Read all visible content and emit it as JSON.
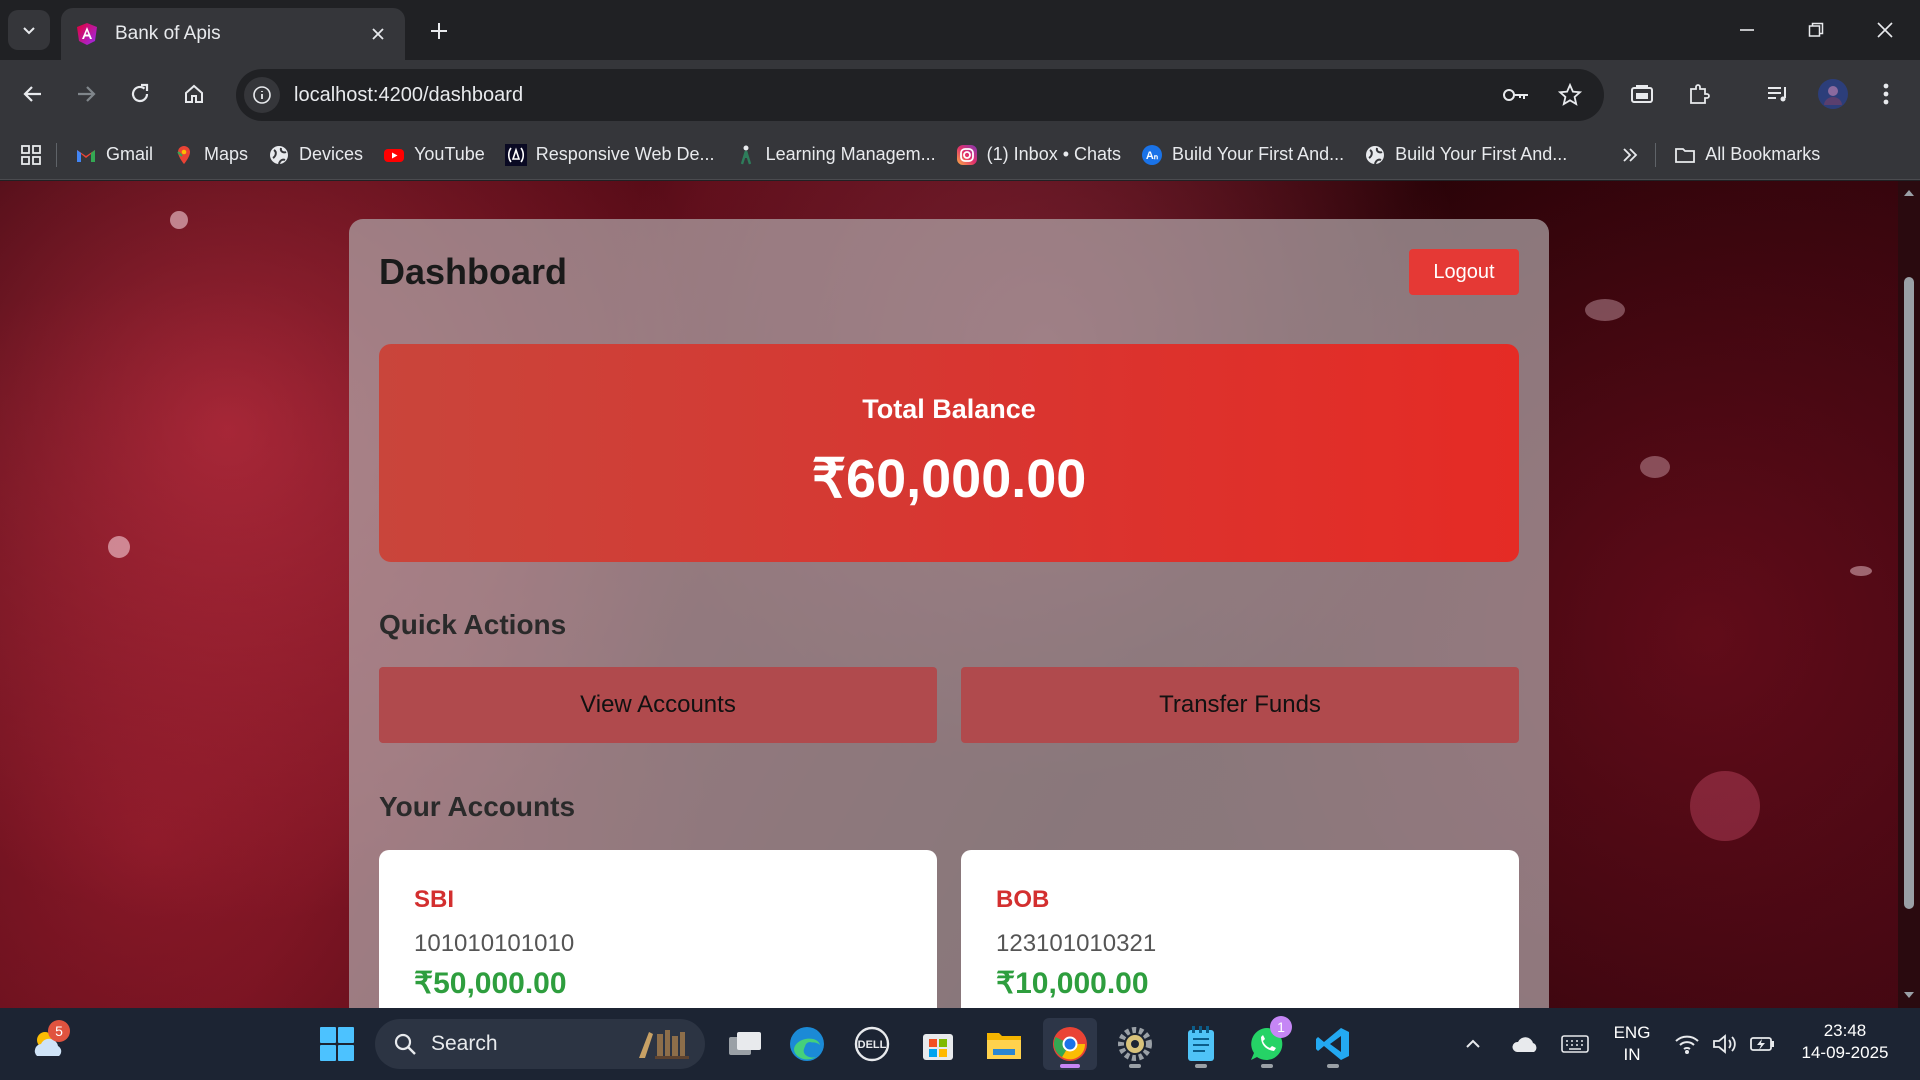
{
  "browser": {
    "tab_title": "Bank of Apis",
    "url": "localhost:4200/dashboard",
    "bookmarks": [
      {
        "label": "Gmail",
        "icon": "gmail-icon"
      },
      {
        "label": "Maps",
        "icon": "maps-icon"
      },
      {
        "label": "Devices",
        "icon": "globe-icon"
      },
      {
        "label": "YouTube",
        "icon": "youtube-icon"
      },
      {
        "label": "Responsive Web De...",
        "icon": "freecodecamp-icon"
      },
      {
        "label": "Learning Managem...",
        "icon": "lms-icon"
      },
      {
        "label": "(1) Inbox • Chats",
        "icon": "instagram-icon"
      },
      {
        "label": "Build Your First And...",
        "icon": "android-icon"
      },
      {
        "label": "Build Your First And...",
        "icon": "globe-icon"
      }
    ],
    "all_bookmarks_label": "All Bookmarks"
  },
  "dashboard": {
    "title": "Dashboard",
    "logout_label": "Logout",
    "total_balance_label": "Total Balance",
    "total_balance": "₹60,000.00",
    "quick_actions_title": "Quick Actions",
    "view_accounts_label": "View Accounts",
    "transfer_funds_label": "Transfer Funds",
    "your_accounts_title": "Your Accounts",
    "accounts": [
      {
        "bank": "SBI",
        "number": "101010101010",
        "balance": "₹50,000.00"
      },
      {
        "bank": "BOB",
        "number": "123101010321",
        "balance": "₹10,000.00"
      }
    ]
  },
  "taskbar": {
    "weather_badge": "5",
    "search_placeholder": "Search",
    "whatsapp_badge": "1",
    "language_line1": "ENG",
    "language_line2": "IN",
    "time": "23:48",
    "date": "14-09-2025"
  },
  "colors": {
    "accent_red": "#e53935",
    "balance_green": "#2e9e3e",
    "bank_name_red": "#d32f2f"
  }
}
